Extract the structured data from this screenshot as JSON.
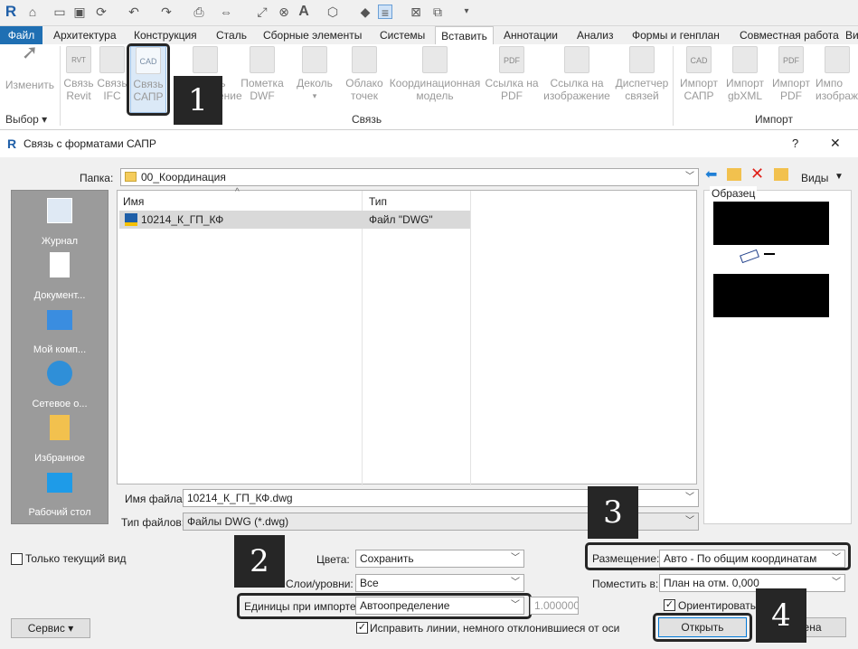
{
  "qat": {
    "icons": [
      "revit-logo-icon",
      "home-icon",
      "open-icon",
      "save-icon",
      "sync-icon",
      "undo-icon",
      "redo-icon",
      "print-icon",
      "measure-icon",
      "dimension-icon",
      "text-icon",
      "3d-view-icon",
      "tag-icon",
      "thin-lines-icon",
      "close-windows-icon",
      "switch-windows-icon",
      "customize-icon"
    ]
  },
  "tabs": [
    "Файл",
    "Архитектура",
    "Конструкция",
    "Сталь",
    "Сборные элементы",
    "Системы",
    "Вставить",
    "Аннотации",
    "Анализ",
    "Формы и генплан",
    "Совместная работа",
    "Вид"
  ],
  "ribbon": {
    "modify": "Изменить",
    "select": "Выбор ▾",
    "link_group": "Связь",
    "import_group": "Импорт",
    "buttons": [
      {
        "l1": "Связь",
        "l2": "Revit"
      },
      {
        "l1": "Связь",
        "l2": "IFC"
      },
      {
        "l1": "Связь",
        "l2": "САПР"
      },
      {
        "l1": "Связать",
        "l2": "изображение"
      },
      {
        "l1": "Пометка",
        "l2": "DWF"
      },
      {
        "l1": "Деколь",
        "l2": "▾"
      },
      {
        "l1": "Облако",
        "l2": "точек"
      },
      {
        "l1": "Координационная",
        "l2": "модель"
      },
      {
        "l1": "Ссылка на",
        "l2": "PDF"
      },
      {
        "l1": "Ссылка на",
        "l2": "изображение"
      },
      {
        "l1": "Диспетчер",
        "l2": "связей"
      },
      {
        "l1": "Импорт",
        "l2": "САПР"
      },
      {
        "l1": "Импорт",
        "l2": "gbXML"
      },
      {
        "l1": "Импорт",
        "l2": "PDF"
      },
      {
        "l1": "Импо",
        "l2": "изображе"
      }
    ],
    "icon_cad": "CAD",
    "icon_pdf": "PDF",
    "icon_rvt": "RVT"
  },
  "callouts": {
    "c1": "1",
    "c2": "2",
    "c3": "3",
    "c4": "4"
  },
  "dialog": {
    "title": "Связь с форматами САПР",
    "help": "?",
    "close": "✕",
    "folder_label": "Папка:",
    "folder": "00_Координация",
    "views_label": "Виды",
    "preview_label": "Образец",
    "places": [
      "Журнал",
      "Документ...",
      "Мой комп...",
      "Сетевое о...",
      "Избранное",
      "Рабочий стол"
    ],
    "columns": {
      "name": "Имя",
      "type": "Тип"
    },
    "files": [
      {
        "name": "10214_К_ГП_КФ",
        "type": "Файл \"DWG\""
      }
    ],
    "filename_label": "Имя файла:",
    "filename": "10214_К_ГП_КФ.dwg",
    "filetype_label": "Тип файлов:",
    "filetype": "Файлы DWG  (*.dwg)",
    "current_view_only": "Только текущий вид",
    "colors_label": "Цвета:",
    "colors": "Сохранить",
    "layers_label": "Слои/уровни:",
    "layers": "Все",
    "units_label": "Единицы при импорте:",
    "units": "Автоопределение",
    "scale": "1.000000",
    "fix_lines": "Исправить линии, немного отклонившиеся от оси",
    "placement_label": "Размещение:",
    "placement": "Авто - По общим координатам",
    "place_at_label": "Поместить в:",
    "place_at": "План на отм. 0,000",
    "orient": "Ориентировать по виду",
    "service": "Сервис",
    "open": "Открыть",
    "cancel": "Отмена"
  }
}
